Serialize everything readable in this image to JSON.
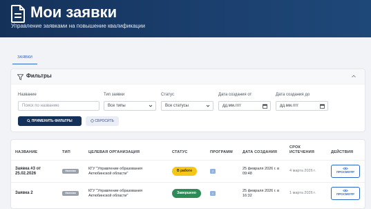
{
  "header": {
    "title": "Мои заявки",
    "subtitle": "Управление заявками на повышение квалификации",
    "icon": "document-icon"
  },
  "tabs": [
    {
      "label": "ЗАЯВКИ",
      "active": true
    }
  ],
  "filters": {
    "title": "Фильтры",
    "name_label": "Название",
    "name_placeholder": "Поиск по названию",
    "type_label": "Тип заявки",
    "type_value": "Все типы",
    "status_label": "Статус",
    "status_value": "Все статусы",
    "date_from_label": "Дата создания от",
    "date_from_placeholder": "дд.мм.гггг",
    "date_to_label": "Дата создания до",
    "date_to_placeholder": "дд.мм.гггг",
    "apply_label": "ПРИМЕНИТЬ ФИЛЬТРЫ",
    "reset_label": "СБРОСИТЬ"
  },
  "table": {
    "headers": {
      "name": "НАЗВАНИЕ",
      "type": "ТИП",
      "org": "ЦЕЛЕВАЯ ОРГАНИЗАЦИЯ",
      "status": "СТАТУС",
      "programs": "ПРОГРАММ",
      "created": "ДАТА СОЗДАНИЯ",
      "expiry_1": "СРОК",
      "expiry_2": "ИСТЕЧЕНИЯ",
      "actions": "ДЕЙСТВИЯ"
    },
    "rows": [
      {
        "name_1": "Заявка #3 от",
        "name_2": "25.02.2026",
        "type": "Именная",
        "org_1": "КГУ \"Управление образования",
        "org_2": "Актюбинской области\"",
        "status": "В работе",
        "status_color": "#f5c518",
        "programs": "2",
        "created_1": "25 февраля 2026 г. в",
        "created_2": "09:48",
        "expiry": "4 марта 2026 г.",
        "action": "ПРОСМОТР"
      },
      {
        "name_1": "Заявка 2",
        "name_2": "",
        "type": "Именная",
        "org_1": "КГУ \"Управление образования",
        "org_2": "Актюбинской области\"",
        "status": "Завершено",
        "status_color": "#2e8b57",
        "programs": "1",
        "created_1": "25 февраля 2026 г. в",
        "created_2": "16:32",
        "expiry": "1 марта 2026 г.",
        "action": "ПРОСМОТР"
      }
    ]
  },
  "colors": {
    "header_bg": "#143159",
    "accent": "#2a67c9",
    "status_in_progress": "#f5c518",
    "status_done": "#2e8b57"
  }
}
